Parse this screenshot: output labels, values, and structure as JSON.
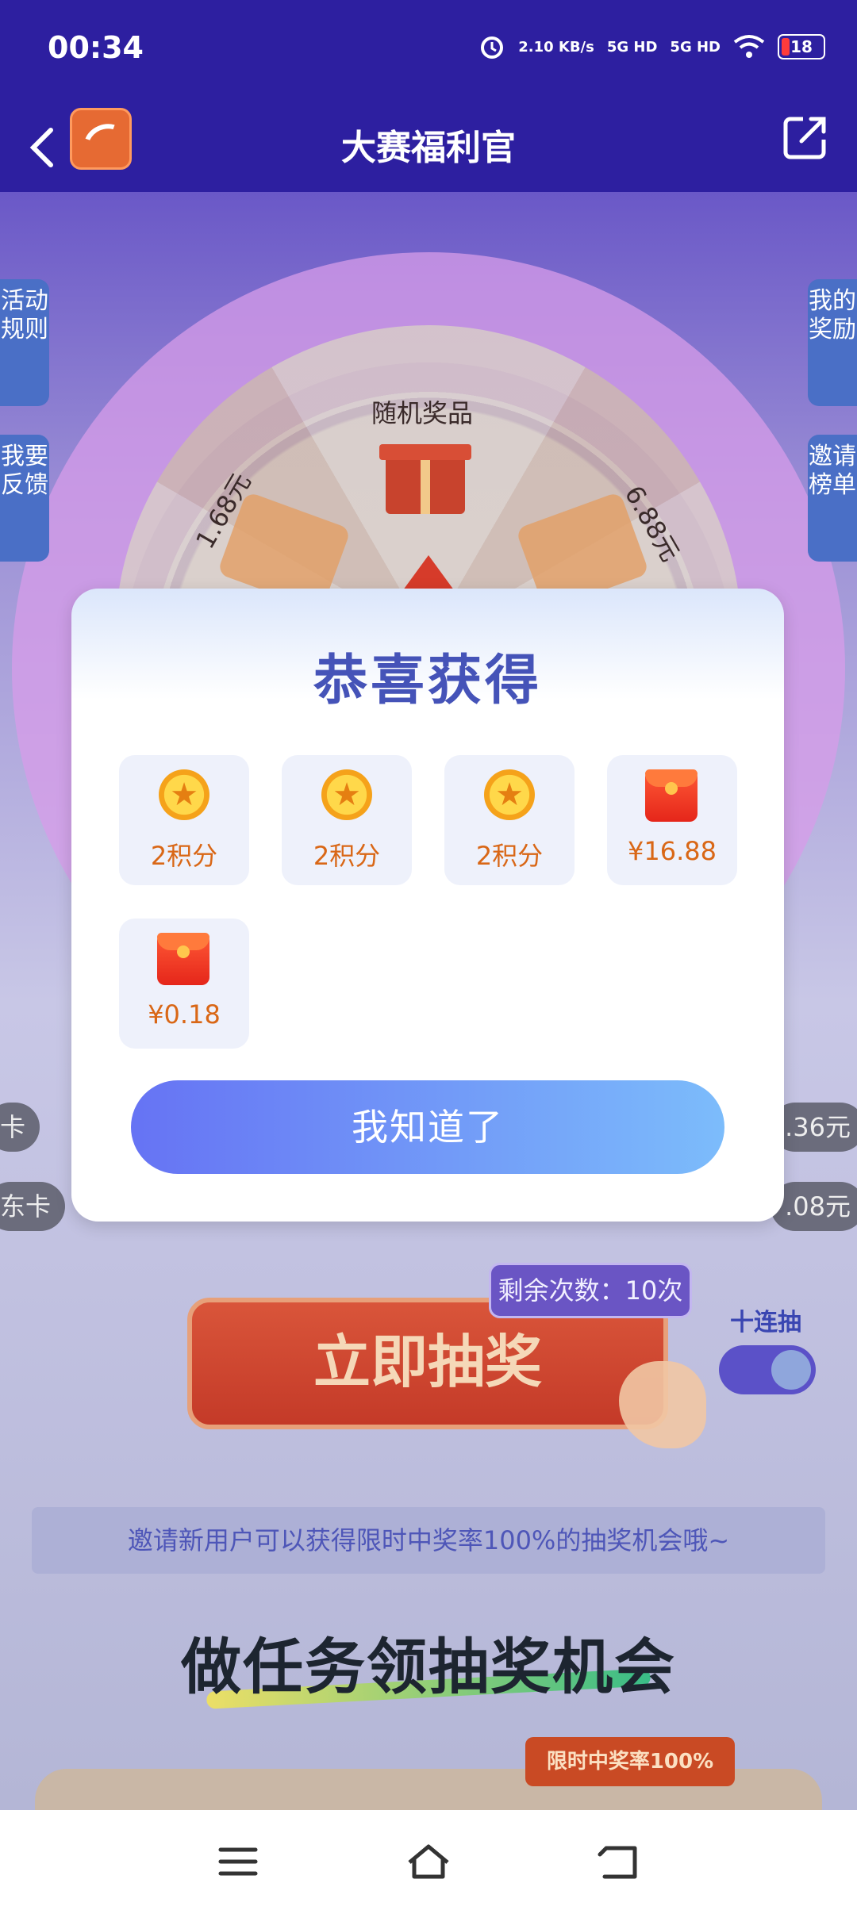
{
  "status_bar": {
    "time": "00:34",
    "net_speed": "2.10 KB/s",
    "sim1": "5G HD",
    "sim2": "5G HD",
    "battery": "18",
    "icons": [
      "alarm-icon",
      "signal-icon",
      "wifi-icon",
      "battery-icon"
    ]
  },
  "nav": {
    "title": "大赛福利官",
    "back_icon": "chevron-left-icon",
    "share_icon": "share-icon"
  },
  "background": {
    "side_tabs": {
      "rules": "活动规则",
      "feedback": "我要反馈",
      "my_rewards": "我的奖励",
      "invite_rank": "邀请榜单"
    },
    "wheel": {
      "top": "随机奖品",
      "left": "1.68元",
      "right": "6.88元"
    },
    "pills": {
      "left_1": "卡",
      "left_2": "东卡",
      "right_1": ".36元",
      "right_2": ".08元"
    },
    "draw_button": "立即抽奖",
    "remaining": "剩余次数：10次",
    "ten_draw": "十连抽",
    "ten_draw_on": true,
    "invite_tip": "邀请新用户可以获得限时中奖率100%的抽奖机会哦~",
    "task_title": "做任务领抽奖机会",
    "task_badge": "限时中奖率100%"
  },
  "modal": {
    "title": "恭喜获得",
    "prizes": [
      {
        "icon": "coin-icon",
        "label": "2积分"
      },
      {
        "icon": "coin-icon",
        "label": "2积分"
      },
      {
        "icon": "coin-icon",
        "label": "2积分"
      },
      {
        "icon": "red-packet-icon",
        "label": "¥16.88"
      },
      {
        "icon": "red-packet-icon",
        "label": "¥0.18"
      }
    ],
    "confirm": "我知道了"
  },
  "system_nav": [
    "menu-icon",
    "home-icon",
    "back-icon"
  ]
}
